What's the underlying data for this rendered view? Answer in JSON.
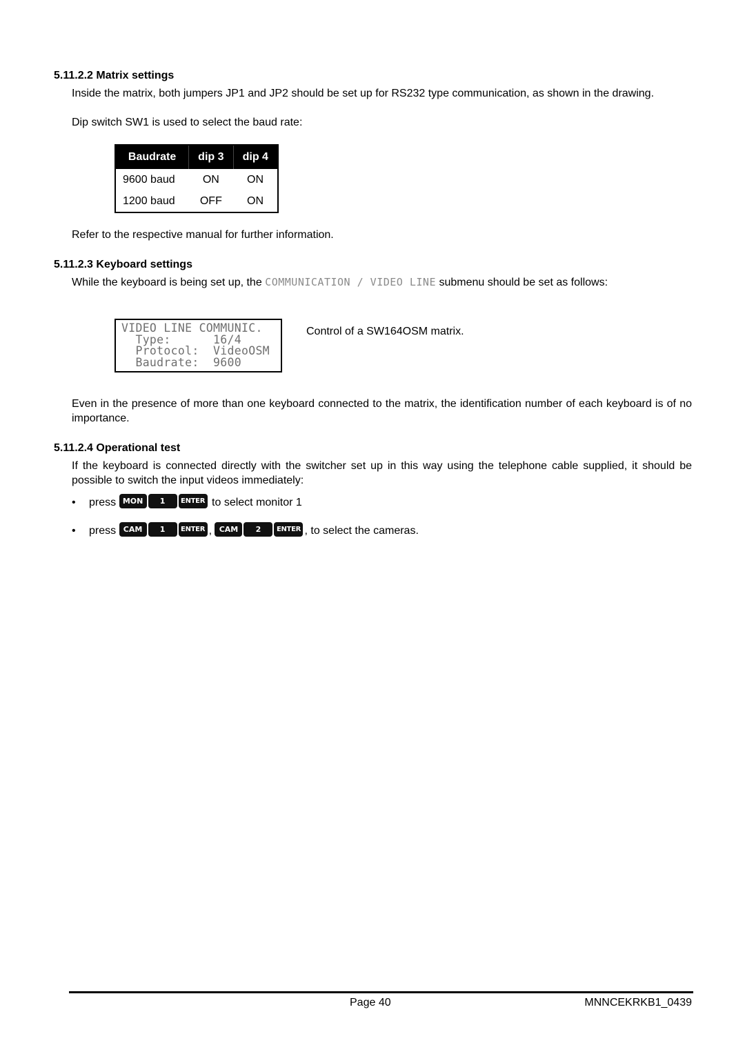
{
  "sections": {
    "matrix": {
      "heading": "5.11.2.2 Matrix settings",
      "para1": "Inside the matrix, both jumpers JP1 and JP2 should be set up for RS232 type communication, as shown in the drawing.",
      "para2": "Dip switch SW1 is used to select the baud rate:",
      "table": {
        "headers": [
          "Baudrate",
          "dip 3",
          "dip 4"
        ],
        "rows": [
          [
            "9600 baud",
            "ON",
            "ON"
          ],
          [
            "1200 baud",
            "OFF",
            "ON"
          ]
        ]
      },
      "note": "Refer to the respective manual for further information."
    },
    "keyboard": {
      "heading": "5.11.2.3 Keyboard settings",
      "para_before": "While the keyboard is being set up, the",
      "menu_path": "COMMUNICATION / VIDEO LINE",
      "para_after": "submenu should be set as follows:",
      "lcd_lines": [
        "VIDEO LINE COMMUNIC.",
        "  Type:      16/4",
        "  Protocol:  VideoOSM",
        "  Baudrate:  9600"
      ],
      "lcd_caption": "Control of a SW164OSM matrix.",
      "para2": "Even in the presence of more than one keyboard connected to the matrix, the identification number of each keyboard is of no importance."
    },
    "test": {
      "heading": "5.11.2.4 Operational test",
      "para": "If the keyboard is connected directly with the switcher set up in this way using the telephone cable supplied, it should be possible to switch the input videos immediately:",
      "bullet_glyph": "•",
      "bullets": [
        {
          "prefix": "press",
          "keys": [
            "MON",
            "1",
            "ENTER"
          ],
          "suffix": "to select monitor 1"
        },
        {
          "prefix": "press",
          "keys_a": [
            "CAM",
            "1",
            "ENTER"
          ],
          "separator": ",",
          "keys_b": [
            "CAM",
            "2",
            "ENTER"
          ],
          "suffix": ", to select the cameras."
        }
      ]
    }
  },
  "footer": {
    "page": "Page 40",
    "doc_code": "MNNCEKRKB1_0439"
  }
}
